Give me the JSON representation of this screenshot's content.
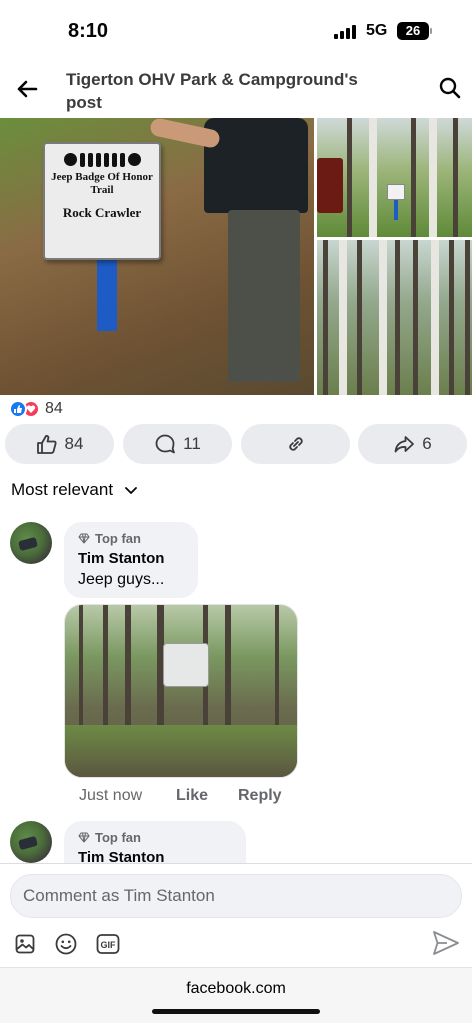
{
  "status_bar": {
    "time": "8:10",
    "network": "5G",
    "battery": "26"
  },
  "header": {
    "title": "Tigerton OHV Park & Campground's post",
    "back_icon": "arrow-left-icon",
    "search_icon": "search-icon"
  },
  "photos": {
    "sign_line1": "Jeep Badge Of Honor Trail",
    "sign_line2": "Rock Crawler"
  },
  "reactions": {
    "count": "84",
    "types": [
      "like",
      "love"
    ],
    "like_color": "#1877f2",
    "love_color": "#f33e58"
  },
  "actions": {
    "like_count": "84",
    "comment_count": "11",
    "share_count": "6"
  },
  "sort": {
    "label": "Most relevant"
  },
  "comments": [
    {
      "badge": "Top fan",
      "author": "Tim Stanton",
      "text": "Jeep guys...",
      "time": "Just now",
      "like_label": "Like",
      "reply_label": "Reply"
    },
    {
      "badge": "Top fan",
      "author": "Tim Stanton"
    }
  ],
  "composer": {
    "placeholder": "Comment as Tim Stanton"
  },
  "browser": {
    "url": "facebook.com"
  },
  "colors": {
    "accent": "#1877f2",
    "button_bg": "#e9ebee",
    "bubble_bg": "#f0f2f5",
    "secondary_text": "#65676b"
  }
}
